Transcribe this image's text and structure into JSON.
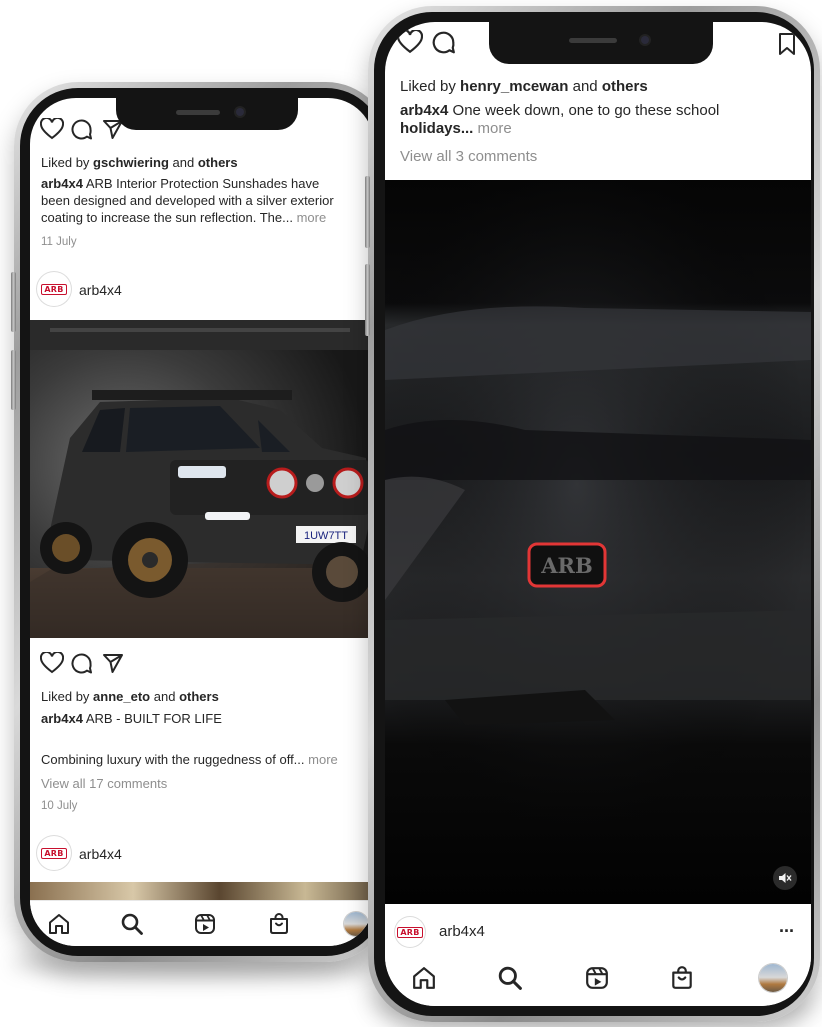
{
  "left_phone": {
    "top_post": {
      "liked_prefix": "Liked by",
      "liked_user": "gschwiering",
      "liked_mid": "and",
      "liked_others": "others",
      "caption_line1_user": "arb4x4",
      "caption_line1": "ARB Interior Protection Sunshades have",
      "caption_line2": "been designed and developed with a silver exterior",
      "caption_line3": "coating to increase the sun reflection. The...",
      "more": "more",
      "date": "11 July"
    },
    "post2": {
      "username": "arb4x4",
      "plate": "1UW7TT",
      "liked_prefix": "Liked by",
      "liked_user": "anne_eto",
      "liked_mid": "and",
      "liked_others": "others",
      "caption_user": "arb4x4",
      "caption": "ARB - BUILT FOR LIFE",
      "caption2": "Combining luxury with the ruggedness of off...",
      "more": "more",
      "view_comments": "View all 17 comments",
      "date": "10 July"
    },
    "post3": {
      "username": "arb4x4"
    },
    "tabbar": [
      "home-icon",
      "search-icon",
      "reels-icon",
      "shop-icon",
      "profile-avatar"
    ]
  },
  "right_phone": {
    "top_post": {
      "liked_prefix": "Liked by",
      "liked_user": "henry_mcewan",
      "liked_mid": "and",
      "liked_others": "others",
      "caption_user": "arb4x4",
      "caption_line1": "One week down, one to go these school",
      "caption_line2": "holidays...",
      "more": "more",
      "view_comments": "View all 3 comments"
    },
    "video": {
      "logo_text": "ARB",
      "mute_icon": "speaker-muted-icon"
    },
    "post2": {
      "username": "arb4x4",
      "options": "..."
    },
    "tabbar": [
      "home-icon",
      "search-icon",
      "reels-icon",
      "shop-icon",
      "profile-avatar"
    ]
  },
  "brand": {
    "badge": "ARB"
  },
  "colors": {
    "arb_red": "#c8102e",
    "text": "#262626",
    "muted": "#8e8e8e",
    "bezel": "#141414"
  }
}
